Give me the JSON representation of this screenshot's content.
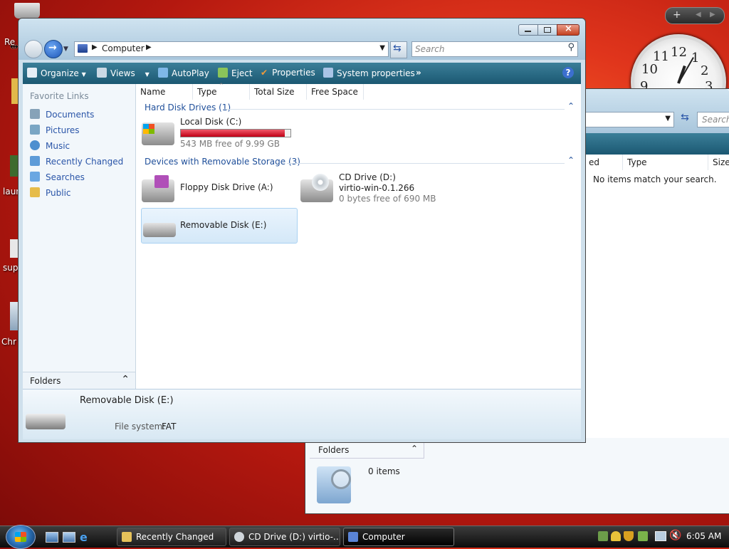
{
  "desktop": {
    "icons": [
      {
        "label": "Re",
        "top": 0
      },
      {
        "label": "laun",
        "top": 0
      },
      {
        "label": "sup",
        "top": 0
      },
      {
        "label": "Chr",
        "top": 0
      }
    ]
  },
  "gadget": {
    "add": "+",
    "clock_numbers": [
      "12",
      "1",
      "2",
      "3",
      "9",
      "10",
      "11"
    ]
  },
  "main_window": {
    "address": {
      "root": "Computer"
    },
    "search": {
      "placeholder": "Search"
    },
    "toolbar": {
      "organize": "Organize",
      "views": "Views",
      "autoplay": "AutoPlay",
      "eject": "Eject",
      "properties": "Properties",
      "system_properties": "System properties",
      "more": "»",
      "help": "?"
    },
    "nav": {
      "favorite_links": "Favorite Links",
      "links": [
        "Documents",
        "Pictures",
        "Music",
        "Recently Changed",
        "Searches",
        "Public"
      ],
      "folders": "Folders"
    },
    "columns": [
      "Name",
      "Type",
      "Total Size",
      "Free Space"
    ],
    "groups": {
      "hard_disks": "Hard Disk Drives (1)",
      "removable": "Devices with Removable Storage (3)"
    },
    "local_disk": {
      "name": "Local Disk (C:)",
      "free": "543 MB free of 9.99 GB",
      "used_fraction": 0.947
    },
    "floppy": {
      "name": "Floppy Disk Drive (A:)"
    },
    "cd": {
      "name": "CD Drive (D:)",
      "label": "virtio-win-0.1.266",
      "free": "0 bytes free of 690 MB"
    },
    "removable": {
      "name": "Removable Disk (E:)"
    },
    "details": {
      "name": "Removable Disk (E:)",
      "fs_label": "File system:",
      "fs_value": "FAT"
    }
  },
  "back_window": {
    "search": {
      "placeholder": "Search"
    },
    "columns": [
      "ed",
      "Type",
      "Size"
    ],
    "empty": "No items match your search.",
    "folders": "Folders",
    "items": "0 items"
  },
  "taskbar": {
    "buttons": [
      "Recently Changed",
      "CD Drive (D:) virtio-...",
      "Computer"
    ],
    "time": "6:05 AM"
  },
  "colors": {
    "toolbar": "#1b5872",
    "link": "#2a55a8",
    "disk_bar": "#d8001c",
    "selection": "#dcecfa"
  }
}
